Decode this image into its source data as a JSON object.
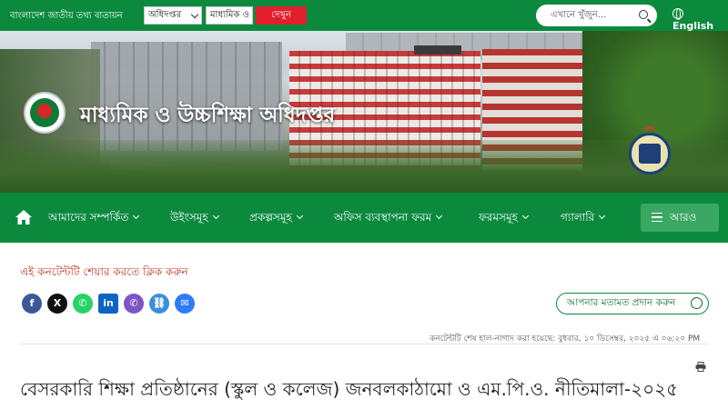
{
  "topbar": {
    "portal_title": "বাংলাদেশ জাতীয় তথ্য বাতায়ন",
    "office_select": "অধিদপ্তর",
    "sector_select": "মাধ্যমিক ও উচ্চ",
    "see_button": "দেখুন",
    "search_placeholder": "এখানে খুঁজুন...",
    "language": "English"
  },
  "header": {
    "site_title": "মাধ্যমিক ও উচ্চশিক্ষা অধিদপ্তর"
  },
  "nav": {
    "items": [
      {
        "label": "আমাদের সম্পর্কিত"
      },
      {
        "label": "উইংসমূহ"
      },
      {
        "label": "প্রকল্পসমূহ"
      },
      {
        "label": "অফিস ব্যবস্থাপনা ফরম"
      },
      {
        "label": "ফরমসমূহ"
      },
      {
        "label": "গ্যালারি"
      }
    ],
    "more_label": "আরও"
  },
  "content": {
    "share_label": "এই কনটেন্টটি শেয়ার করতে ক্লিক করুন",
    "social": [
      {
        "icon": "facebook-icon",
        "glyph": "f",
        "color": "#3b5998"
      },
      {
        "icon": "x-icon",
        "glyph": "X",
        "color": "#111111"
      },
      {
        "icon": "whatsapp-icon",
        "glyph": "✆",
        "color": "#25d366"
      },
      {
        "icon": "linkedin-icon",
        "glyph": "in",
        "color": "#0a66c2"
      },
      {
        "icon": "viber-icon",
        "glyph": "✆",
        "color": "#7d55c7"
      },
      {
        "icon": "copy-link-icon",
        "glyph": "⛓",
        "color": "#3d8fd9"
      },
      {
        "icon": "messenger-icon",
        "glyph": "✉",
        "color": "#2f7cf6"
      }
    ],
    "feedback_button": "আপনার মতামত প্রদান করুন",
    "last_updated": "কনটেন্টটি শেষ হাল-নাগাদ করা হয়েছে: বুধবার, ১০ ডিসেম্বর, ২০২৫ এ ০৬:২০ PM",
    "heading": "বেসরকারি শিক্ষা প্রতিষ্ঠানের (স্কুল ও কলেজ) জনবলকাঠামো ও এম.পি.ও. নীতিমালা-২০২৫"
  },
  "colors": {
    "brand_green": "#0b8a3e",
    "see_button_red": "#e2202c",
    "share_label_red": "#c0392b"
  }
}
